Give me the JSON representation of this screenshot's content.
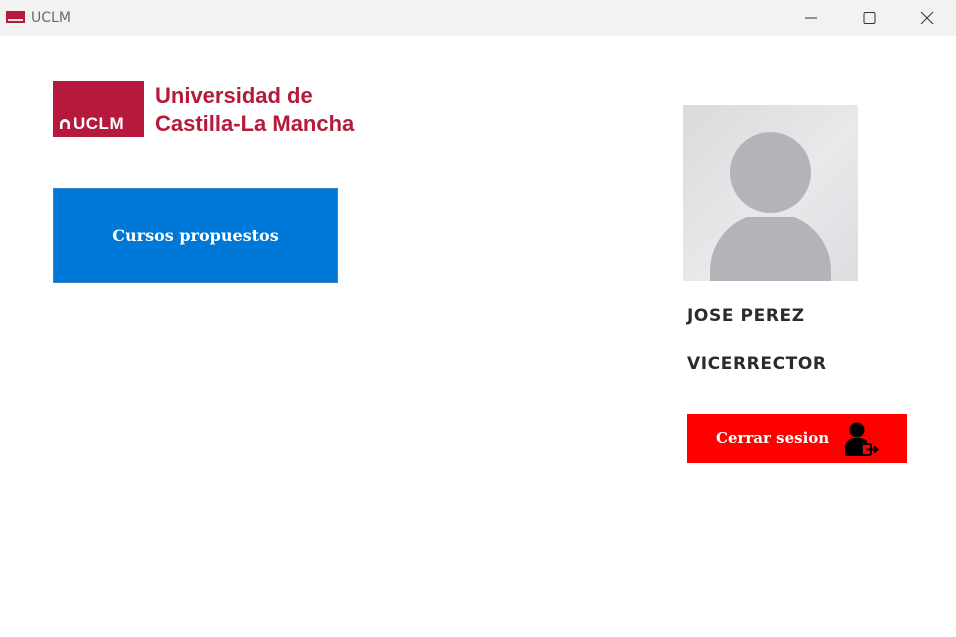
{
  "window": {
    "title": "UCLM",
    "icon": "uclm-logo-icon",
    "controls": [
      "minimize-icon",
      "maximize-icon",
      "close-icon"
    ]
  },
  "logo": {
    "acronym": "UCLM",
    "line1": "Universidad de",
    "line2": "Castilla-La Mancha",
    "brand_color": "#b5193b"
  },
  "main": {
    "courses_button_label": "Cursos propuestos",
    "courses_button_color": "#0078d7"
  },
  "profile": {
    "avatar_icon": "user-placeholder-avatar",
    "name": "JOSE PEREZ",
    "role": "VICERRECTOR"
  },
  "logout": {
    "label": "Cerrar sesion",
    "icon": "user-logout-icon",
    "color": "#ff0000"
  }
}
